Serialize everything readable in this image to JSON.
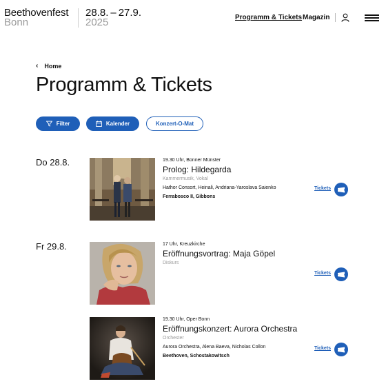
{
  "header": {
    "logo_name": "Beethovenfest",
    "logo_city": "Bonn",
    "logo_dates": "28.8. – 27.9.",
    "logo_year": "2025",
    "nav": [
      {
        "label": "Programm & Tickets",
        "active": true
      },
      {
        "label": "Magazin",
        "active": false
      }
    ],
    "user_icon": "user-icon",
    "menu_icon": "hamburger-menu-icon"
  },
  "breadcrumb": {
    "label": "Home",
    "icon": "chevron-left-icon"
  },
  "page_title": "Programm & Tickets",
  "filters": {
    "filter_label": "Filter",
    "kalender_label": "Kalender",
    "konzert_label": "Konzert-O-Mat"
  },
  "days": [
    {
      "date": "Do 28.8.",
      "events": [
        {
          "meta": "19.30 Uhr, Bonner Münster",
          "title": "Prolog: Hildegarda",
          "genre": "Kammermusik, Vokal",
          "performers": "Hathor Consort, Heinali, Andriana-Yaroslava Saienko",
          "composers": "Ferrabosco II, Gibbons",
          "tickets_label": "Tickets"
        }
      ]
    },
    {
      "date": "Fr 29.8.",
      "events": [
        {
          "meta": "17 Uhr, Kreuzkirche",
          "title": "Eröffnungsvortrag: Maja Göpel",
          "genre": "Diskurs",
          "performers": "",
          "composers": "",
          "tickets_label": "Tickets"
        },
        {
          "meta": "19.30 Uhr, Oper Bonn",
          "title": "Eröffnungskonzert: Aurora Orchestra",
          "genre": "Orchester",
          "performers": "Aurora Orchestra, Alena Baeva, Nicholas Collon",
          "composers": "Beethoven, Schostakowitsch",
          "tickets_label": "Tickets"
        }
      ]
    }
  ],
  "colors": {
    "accent": "#1f5fb8",
    "muted_text": "#9a9a9a"
  }
}
